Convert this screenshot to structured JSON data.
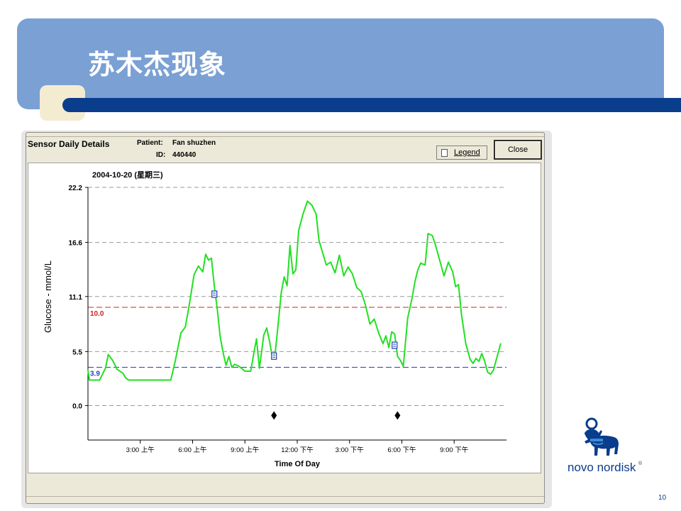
{
  "slide": {
    "title": "苏木杰现象",
    "page_number": "10"
  },
  "window": {
    "title": "Sensor Daily Details",
    "patient_label": "Patient:",
    "patient_name": "Fan shuzhen",
    "id_label": "ID:",
    "id_value": "440440",
    "legend_button": "Legend",
    "close_button": "Close"
  },
  "logo": {
    "text": "novo nordisk",
    "mark": "®",
    "icon": "apis-bull-logo"
  },
  "chart_data": {
    "type": "line",
    "title": "2004-10-20 (星期三)",
    "xlabel": "Time Of Day",
    "ylabel": "Glucose - mmol/L",
    "xlim": [
      "00:00",
      "24:00"
    ],
    "ylim": [
      -3.5,
      22.2
    ],
    "x_ticks": [
      {
        "t": "03:00",
        "label": "3:00 上午"
      },
      {
        "t": "06:00",
        "label": "6:00 上午"
      },
      {
        "t": "09:00",
        "label": "9:00 上午"
      },
      {
        "t": "12:00",
        "label": "12:00 下午"
      },
      {
        "t": "15:00",
        "label": "3:00 下午"
      },
      {
        "t": "18:00",
        "label": "6:00 下午"
      },
      {
        "t": "21:00",
        "label": "9:00 下午"
      }
    ],
    "y_ticks": [
      {
        "v": 22.2,
        "label": "22.2"
      },
      {
        "v": 16.6,
        "label": "16.6"
      },
      {
        "v": 11.1,
        "label": "11.1"
      },
      {
        "v": 5.5,
        "label": "5.5"
      },
      {
        "v": 0.0,
        "label": "0.0"
      }
    ],
    "grid": true,
    "thresholds": [
      {
        "value": 10.0,
        "label": "10.0",
        "color": "#d42020"
      },
      {
        "value": 3.9,
        "label": "3.9",
        "color": "#2a3ec0"
      }
    ],
    "series": [
      {
        "color": "#22e022",
        "points": [
          {
            "t": "00:00",
            "y": 3.6
          },
          {
            "t": "00:05",
            "y": 2.6
          },
          {
            "t": "00:40",
            "y": 2.6
          },
          {
            "t": "01:00",
            "y": 3.8
          },
          {
            "t": "01:10",
            "y": 5.2
          },
          {
            "t": "01:25",
            "y": 4.6
          },
          {
            "t": "01:40",
            "y": 3.7
          },
          {
            "t": "02:00",
            "y": 3.3
          },
          {
            "t": "02:10",
            "y": 2.8
          },
          {
            "t": "02:20",
            "y": 2.6
          },
          {
            "t": "04:45",
            "y": 2.6
          },
          {
            "t": "05:00",
            "y": 4.5
          },
          {
            "t": "05:20",
            "y": 7.4
          },
          {
            "t": "05:35",
            "y": 8.0
          },
          {
            "t": "05:50",
            "y": 10.5
          },
          {
            "t": "06:05",
            "y": 13.3
          },
          {
            "t": "06:20",
            "y": 14.2
          },
          {
            "t": "06:35",
            "y": 13.6
          },
          {
            "t": "06:45",
            "y": 15.4
          },
          {
            "t": "06:55",
            "y": 14.8
          },
          {
            "t": "07:05",
            "y": 15.0
          },
          {
            "t": "07:15",
            "y": 12.1
          },
          {
            "t": "07:25",
            "y": 9.8
          },
          {
            "t": "07:35",
            "y": 7.0
          },
          {
            "t": "07:45",
            "y": 5.4
          },
          {
            "t": "07:55",
            "y": 4.1
          },
          {
            "t": "08:05",
            "y": 5.0
          },
          {
            "t": "08:15",
            "y": 3.9
          },
          {
            "t": "08:25",
            "y": 4.2
          },
          {
            "t": "08:40",
            "y": 4.0
          },
          {
            "t": "09:00",
            "y": 3.5
          },
          {
            "t": "09:20",
            "y": 3.5
          },
          {
            "t": "09:30",
            "y": 5.2
          },
          {
            "t": "09:40",
            "y": 6.8
          },
          {
            "t": "09:50",
            "y": 3.8
          },
          {
            "t": "10:05",
            "y": 7.2
          },
          {
            "t": "10:15",
            "y": 7.9
          },
          {
            "t": "10:25",
            "y": 6.5
          },
          {
            "t": "10:35",
            "y": 4.8
          },
          {
            "t": "10:45",
            "y": 5.6
          },
          {
            "t": "10:55",
            "y": 8.5
          },
          {
            "t": "11:05",
            "y": 11.5
          },
          {
            "t": "11:15",
            "y": 13.1
          },
          {
            "t": "11:25",
            "y": 12.2
          },
          {
            "t": "11:35",
            "y": 16.3
          },
          {
            "t": "11:45",
            "y": 13.4
          },
          {
            "t": "11:55",
            "y": 13.8
          },
          {
            "t": "12:05",
            "y": 17.8
          },
          {
            "t": "12:20",
            "y": 19.5
          },
          {
            "t": "12:35",
            "y": 20.8
          },
          {
            "t": "12:50",
            "y": 20.4
          },
          {
            "t": "13:05",
            "y": 19.5
          },
          {
            "t": "13:15",
            "y": 16.8
          },
          {
            "t": "13:25",
            "y": 15.8
          },
          {
            "t": "13:40",
            "y": 14.3
          },
          {
            "t": "13:55",
            "y": 14.6
          },
          {
            "t": "14:10",
            "y": 13.5
          },
          {
            "t": "14:25",
            "y": 15.3
          },
          {
            "t": "14:40",
            "y": 13.2
          },
          {
            "t": "14:55",
            "y": 14.1
          },
          {
            "t": "15:10",
            "y": 13.4
          },
          {
            "t": "15:25",
            "y": 12.0
          },
          {
            "t": "15:40",
            "y": 11.6
          },
          {
            "t": "15:55",
            "y": 10.2
          },
          {
            "t": "16:10",
            "y": 8.3
          },
          {
            "t": "16:25",
            "y": 8.8
          },
          {
            "t": "16:40",
            "y": 7.4
          },
          {
            "t": "16:55",
            "y": 6.3
          },
          {
            "t": "17:05",
            "y": 7.1
          },
          {
            "t": "17:15",
            "y": 5.9
          },
          {
            "t": "17:25",
            "y": 7.5
          },
          {
            "t": "17:35",
            "y": 7.3
          },
          {
            "t": "17:45",
            "y": 5.0
          },
          {
            "t": "17:55",
            "y": 4.6
          },
          {
            "t": "18:05",
            "y": 4.0
          },
          {
            "t": "18:20",
            "y": 8.9
          },
          {
            "t": "18:35",
            "y": 10.9
          },
          {
            "t": "18:45",
            "y": 12.6
          },
          {
            "t": "18:55",
            "y": 13.8
          },
          {
            "t": "19:05",
            "y": 14.5
          },
          {
            "t": "19:20",
            "y": 14.3
          },
          {
            "t": "19:30",
            "y": 17.5
          },
          {
            "t": "19:45",
            "y": 17.3
          },
          {
            "t": "19:55",
            "y": 16.4
          },
          {
            "t": "20:10",
            "y": 14.8
          },
          {
            "t": "20:25",
            "y": 13.2
          },
          {
            "t": "20:40",
            "y": 14.6
          },
          {
            "t": "20:55",
            "y": 13.6
          },
          {
            "t": "21:05",
            "y": 12.1
          },
          {
            "t": "21:15",
            "y": 12.3
          },
          {
            "t": "21:25",
            "y": 9.3
          },
          {
            "t": "21:40",
            "y": 6.3
          },
          {
            "t": "21:55",
            "y": 4.7
          },
          {
            "t": "22:05",
            "y": 4.3
          },
          {
            "t": "22:15",
            "y": 4.8
          },
          {
            "t": "22:25",
            "y": 4.5
          },
          {
            "t": "22:35",
            "y": 5.3
          },
          {
            "t": "22:45",
            "y": 4.5
          },
          {
            "t": "22:55",
            "y": 3.4
          },
          {
            "t": "23:05",
            "y": 3.2
          },
          {
            "t": "23:15",
            "y": 3.6
          },
          {
            "t": "23:25",
            "y": 4.7
          },
          {
            "t": "23:40",
            "y": 6.3
          }
        ]
      }
    ],
    "event_markers": [
      {
        "t": "07:15",
        "y": 11.3,
        "icon": "note-icon"
      },
      {
        "t": "10:40",
        "y": 5.0,
        "icon": "note-icon"
      },
      {
        "t": "17:35",
        "y": 6.1,
        "icon": "note-icon"
      }
    ],
    "meal_markers": [
      {
        "t": "10:40",
        "y": -1.0,
        "icon": "diamond-icon"
      },
      {
        "t": "17:45",
        "y": -1.0,
        "icon": "diamond-icon"
      }
    ]
  }
}
